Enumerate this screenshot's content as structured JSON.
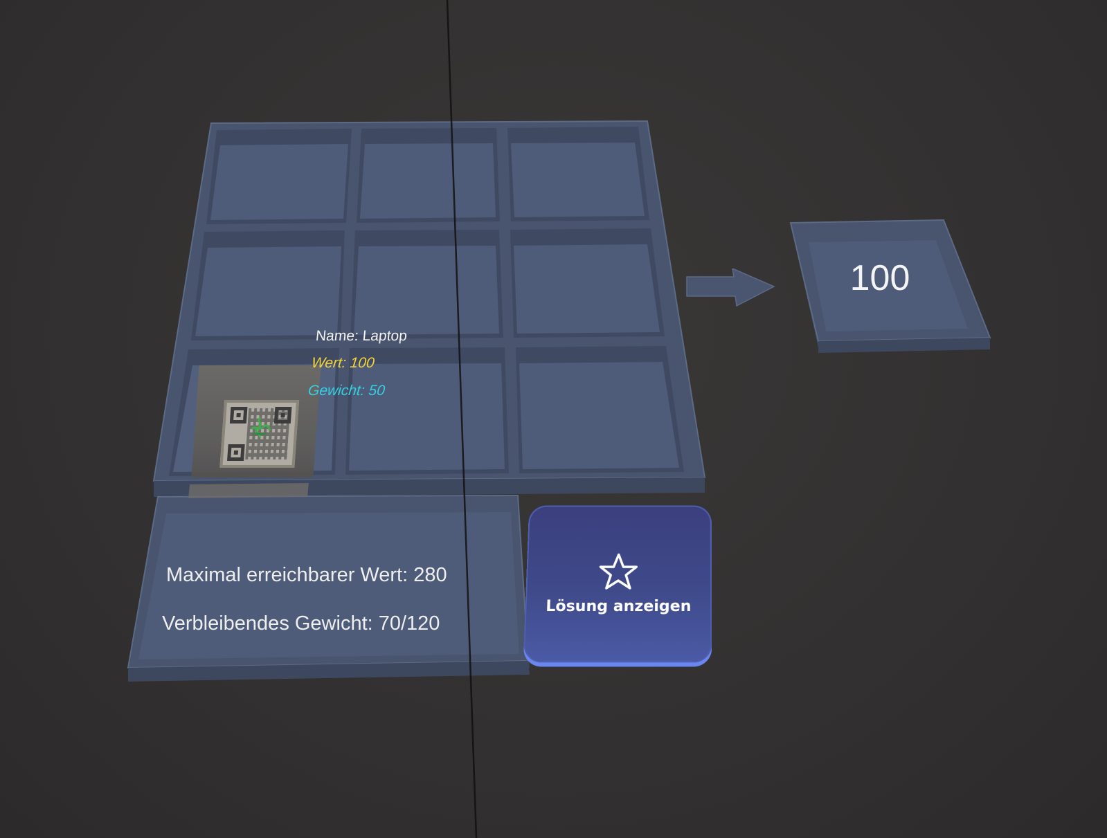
{
  "item": {
    "name_label": "Name: Laptop",
    "value_label": "Wert: 100",
    "weight_label": "Gewicht: 50",
    "value_color": "#f3d43a",
    "weight_color": "#35d0e0",
    "logo_icon": "razer-snake-icon"
  },
  "result": {
    "value": "100"
  },
  "info": {
    "max_value": "Maximal erreichbarer Wert: 280",
    "remaining_weight": "Verbleibendes Gewicht: 70/120"
  },
  "solution_button": {
    "label": "Lösung anzeigen",
    "icon": "star-icon",
    "color": "#3f4a8a",
    "edge_color": "#6a86f0"
  },
  "grid": {
    "rows": 3,
    "cols": 3
  }
}
